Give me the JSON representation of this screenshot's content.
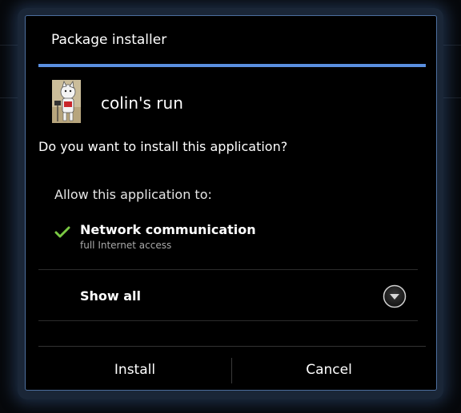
{
  "dialog": {
    "title": "Package installer",
    "app_icon": "app-icon-cartoon-character",
    "app_name": "colin's run",
    "question": "Do you want to install this application?",
    "allow_heading": "Allow this application to:",
    "permissions": [
      {
        "icon": "check-icon",
        "title": "Network communication",
        "description": "full Internet access"
      }
    ],
    "show_all_label": "Show all",
    "expand_icon": "chevron-down-circle-icon"
  },
  "buttons": {
    "install": "Install",
    "cancel": "Cancel"
  },
  "colors": {
    "accent": "#5a8fe0",
    "check": "#7ac943",
    "dialog_border": "#4d6f9e",
    "background": "#000000"
  }
}
